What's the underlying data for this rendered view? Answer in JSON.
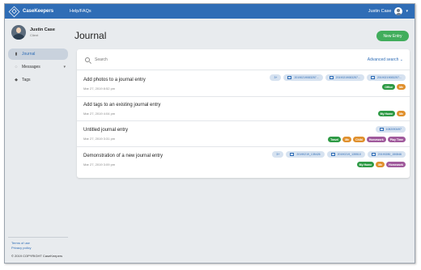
{
  "header": {
    "brand": "CaseKeepers",
    "help": "Help/FAQs",
    "user": "Justin Case"
  },
  "sidebar": {
    "profile_name": "Justin Case",
    "profile_role": "Client",
    "items": [
      {
        "label": "Journal",
        "icon": "book-icon"
      },
      {
        "label": "Messages",
        "icon": "chat-icon"
      },
      {
        "label": "Tags",
        "icon": "tag-icon"
      }
    ],
    "terms": "Terms of use",
    "privacy": "Privacy policy",
    "copyright": "© 2019 COPYRIGHT CaseKeepers"
  },
  "main": {
    "title": "Journal",
    "new_entry": "New Entry",
    "search_placeholder": "Search",
    "advanced_search": "Advanced search"
  },
  "entries": [
    {
      "title": "Add photos to a journal entry",
      "date": "Mar 27, 2019 8:52 pm",
      "attachments": [
        "3+",
        "20190219083257...",
        "20190219083257...",
        "20190219083257..."
      ],
      "tags": [
        {
          "label": "Office",
          "color": "#2e9a45"
        },
        {
          "label": "Me",
          "color": "#e0902d"
        }
      ]
    },
    {
      "title": "Add tags to an existing journal entry",
      "date": "Mar 27, 2019 4:04 pm",
      "attachments": [],
      "tags": [
        {
          "label": "My Home",
          "color": "#2e9a45"
        },
        {
          "label": "Me",
          "color": "#e0902d"
        }
      ]
    },
    {
      "title": "Untitled journal entry",
      "date": "Mar 27, 2019 3:31 pm",
      "attachments": [
        "1082093497"
      ],
      "tags": [
        {
          "label": "Travel",
          "color": "#2e9a45"
        },
        {
          "label": "Me",
          "color": "#e0902d"
        },
        {
          "label": "Child",
          "color": "#e0902d"
        },
        {
          "label": "Homework",
          "color": "#a05a9c"
        },
        {
          "label": "Play Time",
          "color": "#a05a9c"
        }
      ]
    },
    {
      "title": "Demonstration of a new journal entry",
      "date": "Mar 27, 2019 3:09 pm",
      "attachments": [
        "3+",
        "20190219_135426",
        "20190219_135510",
        "20190280_150846"
      ],
      "tags": [
        {
          "label": "My Home",
          "color": "#2e9a45"
        },
        {
          "label": "Me",
          "color": "#e0902d"
        },
        {
          "label": "Homework",
          "color": "#a05a9c"
        }
      ]
    }
  ]
}
